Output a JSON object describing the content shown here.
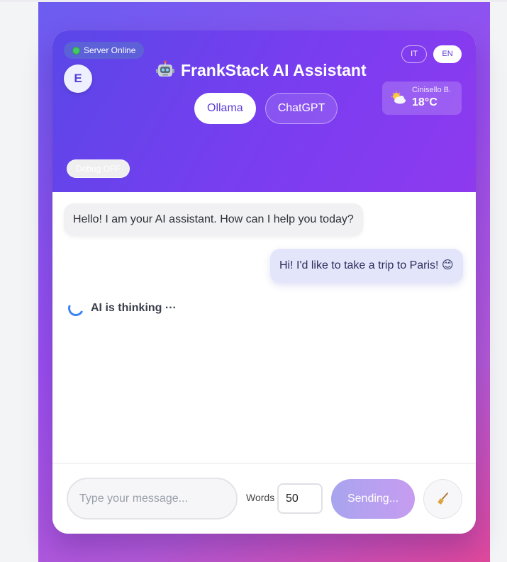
{
  "header": {
    "server_status": "Server Online",
    "avatar_initial": "E",
    "title": "FrankStack AI Assistant",
    "model_tabs": [
      {
        "label": "Ollama",
        "active": true
      },
      {
        "label": "ChatGPT",
        "active": false
      }
    ],
    "languages": [
      {
        "label": "IT",
        "active": false
      },
      {
        "label": "EN",
        "active": true
      }
    ],
    "weather": {
      "city": "Cinisello B.",
      "temperature": "18°C",
      "icon": "partly-cloudy-icon"
    },
    "debug_label": "Debug OFF"
  },
  "chat": {
    "messages": [
      {
        "role": "assistant",
        "text": "Hello! I am your AI assistant. How can I help you today?"
      },
      {
        "role": "user",
        "text": "Hi! I'd like to take a trip to Paris! 😊"
      }
    ],
    "thinking_text": "AI is thinking ···"
  },
  "input_bar": {
    "placeholder": "Type your message...",
    "words_label": "Words",
    "words_value": "50",
    "send_label": "Sending...",
    "clear_icon": "broom-icon"
  },
  "colors": {
    "accent": "#5c3fd6",
    "header_gradient_start": "#5a47e8",
    "header_gradient_end": "#8e3aef",
    "status_online": "#44c767",
    "spinner": "#3b82f6"
  }
}
